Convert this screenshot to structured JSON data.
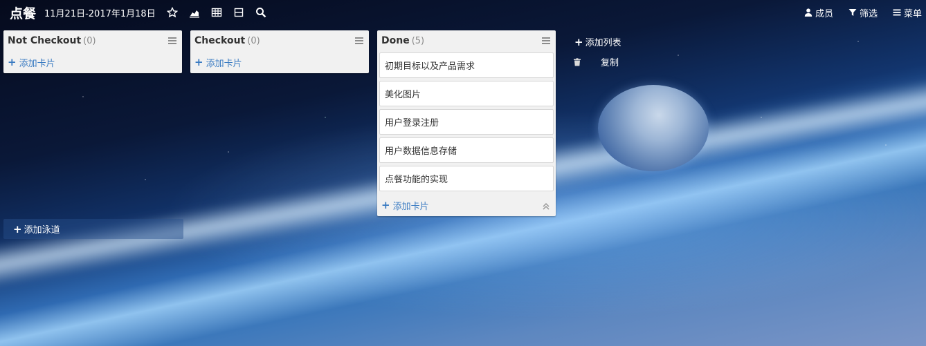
{
  "header": {
    "board_title": "点餐",
    "date_range": "11月21日-2017年1月18日",
    "icons": [
      "star-icon",
      "chart-area-icon",
      "table-icon",
      "swimlane-icon",
      "search-icon"
    ],
    "members_label": "成员",
    "filter_label": "筛选",
    "menu_label": "菜单"
  },
  "lists": [
    {
      "title": "Not Checkout",
      "count": "(0)",
      "add_card_label": "添加卡片",
      "cards": []
    },
    {
      "title": "Checkout",
      "count": "(0)",
      "add_card_label": "添加卡片",
      "cards": []
    },
    {
      "title": "Done",
      "count": "(5)",
      "add_card_label": "添加卡片",
      "cards": [
        "初期目标以及产品需求",
        "美化图片",
        "用户登录注册",
        "用户数据信息存储",
        "点餐功能的实现"
      ]
    }
  ],
  "actions": {
    "add_list_label": "添加列表",
    "copy_label": "复制",
    "add_swimlane_label": "添加泳道"
  },
  "colors": {
    "accent": "#3a7bc2",
    "list_background": "#f1f1f1",
    "header_text": "#ffffff"
  }
}
